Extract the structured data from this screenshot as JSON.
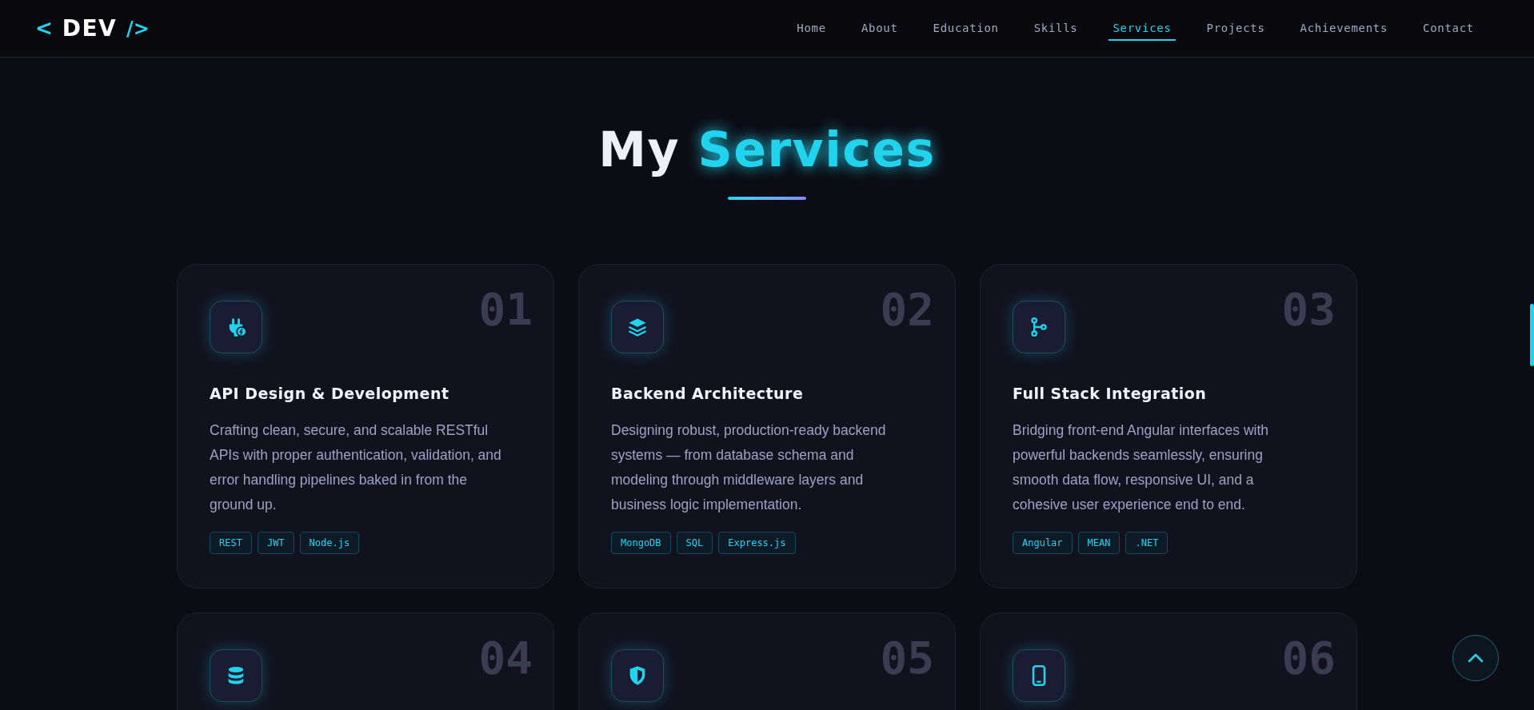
{
  "logo": {
    "open": "<",
    "text": "DEV",
    "close": "/>"
  },
  "nav": [
    {
      "label": "Home",
      "selected": false
    },
    {
      "label": "About",
      "selected": false
    },
    {
      "label": "Education",
      "selected": false
    },
    {
      "label": "Skills",
      "selected": false
    },
    {
      "label": "Services",
      "selected": true
    },
    {
      "label": "Projects",
      "selected": false
    },
    {
      "label": "Achievements",
      "selected": false
    },
    {
      "label": "Contact",
      "selected": false
    }
  ],
  "heading": {
    "plain": "My",
    "accent": "Services"
  },
  "services": [
    {
      "number": "01",
      "kind": "plug",
      "title": "API Design & Development",
      "description": "Crafting clean, secure, and scalable RESTful APIs with proper authentication, validation, and error handling pipelines baked in from the ground up.",
      "tags": [
        "REST",
        "JWT",
        "Node.js"
      ]
    },
    {
      "number": "02",
      "kind": "layers",
      "title": "Backend Architecture",
      "description": "Designing robust, production-ready backend systems — from database schema and modeling through middleware layers and business logic implementation.",
      "tags": [
        "MongoDB",
        "SQL",
        "Express.js"
      ]
    },
    {
      "number": "03",
      "kind": "branch",
      "title": "Full Stack Integration",
      "description": "Bridging front-end Angular interfaces with powerful backends seamlessly, ensuring smooth data flow, responsive UI, and a cohesive user experience end to end.",
      "tags": [
        "Angular",
        "MEAN",
        ".NET"
      ]
    },
    {
      "number": "04",
      "kind": "database"
    },
    {
      "number": "05",
      "kind": "shield"
    },
    {
      "number": "06",
      "kind": "phone"
    }
  ]
}
